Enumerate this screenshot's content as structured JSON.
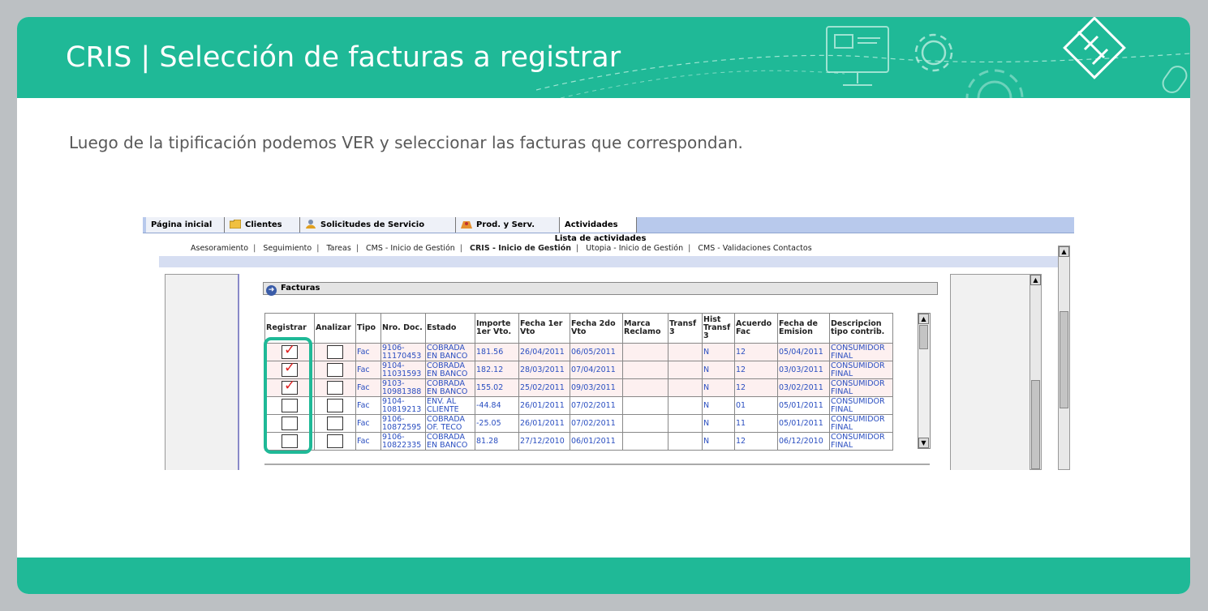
{
  "slide": {
    "title": "CRIS | Selección de facturas a registrar",
    "subtitle": "Luego de la tipificación podemos VER y seleccionar las facturas que correspondan."
  },
  "app": {
    "tabs": [
      {
        "label": "Página inicial",
        "icon": ""
      },
      {
        "label": "Clientes",
        "icon": "folder-icon"
      },
      {
        "label": "Solicitudes de Servicio",
        "icon": "user-icon"
      },
      {
        "label": "Prod. y Serv.",
        "icon": "products-icon"
      },
      {
        "label": "Actividades",
        "icon": ""
      }
    ],
    "active_tab": "Actividades",
    "list_title": "Lista de actividades",
    "subtabs": [
      "Asesoramiento",
      "Seguimiento",
      "Tareas",
      "CMS - Inicio de Gestión",
      "CRIS - Inicio de Gestión",
      "Utopia - Inicio de Gestión",
      "CMS - Validaciones Contactos"
    ],
    "active_subtab": "CRIS - Inicio de Gestión",
    "section_title": "Facturas"
  },
  "table": {
    "columns": [
      "Registrar",
      "Analizar",
      "Tipo",
      "Nro. Doc.",
      "Estado",
      "Importe 1er Vto.",
      "Fecha 1er Vto",
      "Fecha 2do Vto",
      "Marca Reclamo",
      "Transf 3",
      "Hist Transf 3",
      "Acuerdo Fac",
      "Fecha de Emision",
      "Descripcion tipo contrib."
    ],
    "rows": [
      {
        "registrar": true,
        "analizar": false,
        "tipo": "Fac",
        "nro": "9106-11170453",
        "estado": "COBRADA EN BANCO",
        "importe": "181.56",
        "f1": "26/04/2011",
        "f2": "06/05/2011",
        "marca": "",
        "transf": "",
        "hist": "N",
        "acuerdo": "12",
        "emision": "05/04/2011",
        "desc": "CONSUMIDOR FINAL"
      },
      {
        "registrar": true,
        "analizar": false,
        "tipo": "Fac",
        "nro": "9104-11031593",
        "estado": "COBRADA EN BANCO",
        "importe": "182.12",
        "f1": "28/03/2011",
        "f2": "07/04/2011",
        "marca": "",
        "transf": "",
        "hist": "N",
        "acuerdo": "12",
        "emision": "03/03/2011",
        "desc": "CONSUMIDOR FINAL"
      },
      {
        "registrar": true,
        "analizar": false,
        "tipo": "Fac",
        "nro": "9103-10981388",
        "estado": "COBRADA EN BANCO",
        "importe": "155.02",
        "f1": "25/02/2011",
        "f2": "09/03/2011",
        "marca": "",
        "transf": "",
        "hist": "N",
        "acuerdo": "12",
        "emision": "03/02/2011",
        "desc": "CONSUMIDOR FINAL"
      },
      {
        "registrar": false,
        "analizar": false,
        "tipo": "Fac",
        "nro": "9104-10819213",
        "estado": "ENV. AL CLIENTE",
        "importe": "-44.84",
        "f1": "26/01/2011",
        "f2": "07/02/2011",
        "marca": "",
        "transf": "",
        "hist": "N",
        "acuerdo": "01",
        "emision": "05/01/2011",
        "desc": "CONSUMIDOR FINAL"
      },
      {
        "registrar": false,
        "analizar": false,
        "tipo": "Fac",
        "nro": "9106-10872595",
        "estado": "COBRADA OF. TECO",
        "importe": "-25.05",
        "f1": "26/01/2011",
        "f2": "07/02/2011",
        "marca": "",
        "transf": "",
        "hist": "N",
        "acuerdo": "11",
        "emision": "05/01/2011",
        "desc": "CONSUMIDOR FINAL"
      },
      {
        "registrar": false,
        "analizar": false,
        "tipo": "Fac",
        "nro": "9106-10822335",
        "estado": "COBRADA EN BANCO",
        "importe": "81.28",
        "f1": "27/12/2010",
        "f2": "06/01/2011",
        "marca": "",
        "transf": "",
        "hist": "N",
        "acuerdo": "12",
        "emision": "06/12/2010",
        "desc": "CONSUMIDOR FINAL"
      }
    ]
  },
  "colors": {
    "accent": "#1fb997",
    "check": "#e02020",
    "link": "#2a4ec0"
  }
}
